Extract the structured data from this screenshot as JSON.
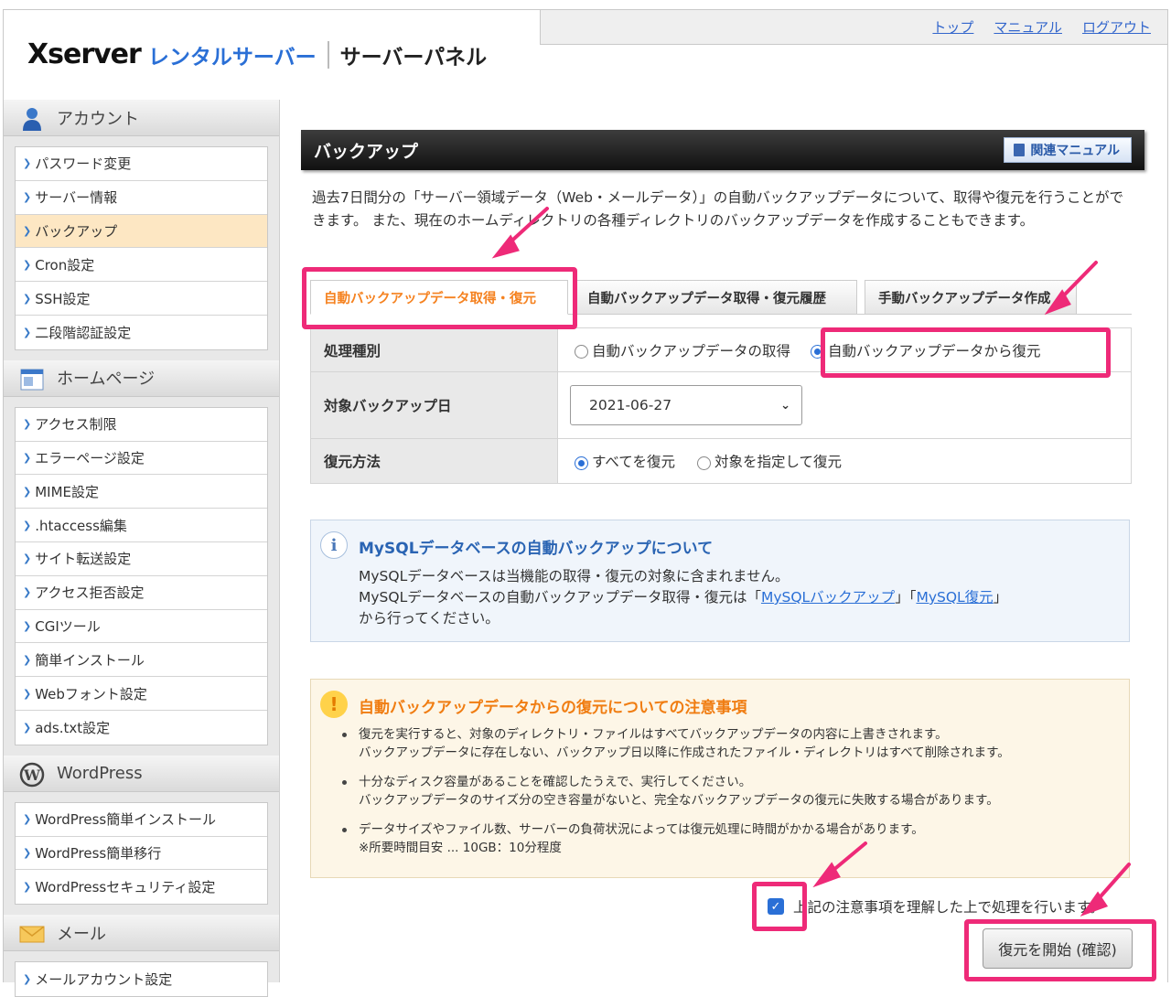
{
  "header": {
    "logo_brand": "Xserver",
    "logo_product": "レンタルサーバー",
    "logo_panel": "サーバーパネル",
    "links": [
      "トップ",
      "マニュアル",
      "ログアウト"
    ]
  },
  "sidebar": {
    "sections": [
      {
        "title": "アカウント",
        "icon": "account-icon",
        "items": [
          "パスワード変更",
          "サーバー情報",
          "バックアップ",
          "Cron設定",
          "SSH設定",
          "二段階認証設定"
        ]
      },
      {
        "title": "ホームページ",
        "icon": "homepage-icon",
        "items": [
          "アクセス制限",
          "エラーページ設定",
          "MIME設定",
          ".htaccess編集",
          "サイト転送設定",
          "アクセス拒否設定",
          "CGIツール",
          "簡単インストール",
          "Webフォント設定",
          "ads.txt設定"
        ]
      },
      {
        "title": "WordPress",
        "icon": "wordpress-icon",
        "items": [
          "WordPress簡単インストール",
          "WordPress簡単移行",
          "WordPressセキュリティ設定"
        ]
      },
      {
        "title": "メール",
        "icon": "mail-icon",
        "items": [
          "メールアカウント設定"
        ]
      }
    ],
    "active_item": "バックアップ"
  },
  "main": {
    "title": "バックアップ",
    "manual_button": "関連マニュアル",
    "description": "過去7日間分の「サーバー領域データ（Web・メールデータ）」の自動バックアップデータについて、取得や復元を行うことができます。 また、現在のホームディレクトリの各種ディレクトリのバックアップデータを作成することもできます。",
    "tabs": [
      "自動バックアップデータ取得・復元",
      "自動バックアップデータ取得・復元履歴",
      "手動バックアップデータ作成"
    ],
    "active_tab": "自動バックアップデータ取得・復元",
    "form": {
      "type_label": "処理種別",
      "type_options": [
        "自動バックアップデータの取得",
        "自動バックアップデータから復元"
      ],
      "type_selected": "自動バックアップデータから復元",
      "date_label": "対象バックアップ日",
      "date_value": "2021-06-27",
      "method_label": "復元方法",
      "method_options": [
        "すべてを復元",
        "対象を指定して復元"
      ],
      "method_selected": "すべてを復元"
    },
    "info": {
      "title": "MySQLデータベースの自動バックアップについて",
      "line1": "MySQLデータベースは当機能の取得・復元の対象に含まれません。",
      "line2_prefix": "MySQLデータベースの自動バックアップデータ取得・復元は「",
      "link1": "MySQLバックアップ",
      "line2_mid": "」「",
      "link2": "MySQL復元",
      "line2_suffix": "」",
      "line3": "から行ってください。"
    },
    "warning": {
      "title": "自動バックアップデータからの復元についての注意事項",
      "items": [
        [
          "復元を実行すると、対象のディレクトリ・ファイルはすべてバックアップデータの内容に上書きされます。",
          "バックアップデータに存在しない、バックアップ日以降に作成されたファイル・ディレクトリはすべて削除されます。"
        ],
        [
          "十分なディスク容量があることを確認したうえで、実行してください。",
          "バックアップデータのサイズ分の空き容量がないと、完全なバックアップデータの復元に失敗する場合があります。"
        ],
        [
          "データサイズやファイル数、サーバーの負荷状況によっては復元処理に時間がかかる場合があります。",
          "※所要時間目安 ... 10GB：10分程度"
        ]
      ]
    },
    "agree_label": "上記の注意事項を理解した上で処理を行います。",
    "agree_checked": true,
    "start_button": "復元を開始 (確認)"
  },
  "colors": {
    "highlight": "#ee2a78",
    "accent_orange": "#f58220",
    "link_blue": "#2a6fd6"
  }
}
